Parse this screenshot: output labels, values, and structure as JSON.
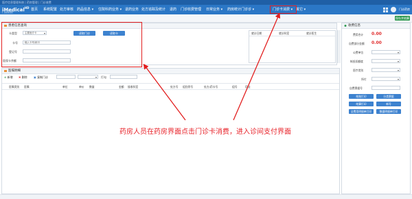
{
  "window": {
    "title": "医疗信息管理系统 | 药房管理 | 门诊收费"
  },
  "brand": {
    "name": "iMedical",
    "version": "HD",
    "subtitle": "门诊药房"
  },
  "nav": {
    "items": [
      {
        "label": "首页"
      },
      {
        "label": "系统配置"
      },
      {
        "label": "处方审核"
      },
      {
        "label": "药品信息 ▾"
      },
      {
        "label": "住院科药业务 ▾"
      },
      {
        "label": "退药业务"
      },
      {
        "label": "处方追踪及统计"
      },
      {
        "label": "退药"
      },
      {
        "label": "门诊收费管理"
      },
      {
        "label": "日常业务 ▾"
      },
      {
        "label": "药房统计门诊诊 ▾"
      },
      {
        "label": "门诊卡消费 ▾"
      },
      {
        "label": "其它 ▾"
      }
    ],
    "user": "门诊药房"
  },
  "toolbar": {
    "save_label": "保存并结算"
  },
  "patient_panel": {
    "title": "患者信息查询",
    "card_type_label": "卡类型",
    "card_type_value": "主要医疗卡",
    "card_no_label": "卡号",
    "card_no_placeholder": "输入卡号/刷卡",
    "reg_no_label": "登记号",
    "balance_label": "医保卡余额",
    "btn_read": "读取门诊",
    "btn_card": "读取卡"
  },
  "history_table": {
    "headers": [
      "就诊日期",
      "就诊科室",
      "就诊医生"
    ]
  },
  "order_panel": {
    "title": "医嘱明细",
    "tools": {
      "add": "新增",
      "delete": "删除",
      "copy": "复制门诊",
      "search_label": "打勾"
    },
    "headers": [
      "医嘱类别",
      "医嘱",
      "单位",
      "单价",
      "数量",
      "金额",
      "接收科室",
      "处方号",
      "组别序号",
      "处方/药卡号",
      "组号",
      "用法"
    ]
  },
  "annotation": {
    "text": "药房人员在药房界面点击门诊卡消费，进入诊间支付界面"
  },
  "pay_panel": {
    "title": "收费信息",
    "fields": [
      {
        "label": "费用合计",
        "value": "0.00"
      },
      {
        "label": "自费部分金额",
        "value": "0.00"
      },
      {
        "label": "公费单位",
        "value": ""
      },
      {
        "label": "帐抵扣额度",
        "value": ""
      },
      {
        "label": "医疗类别",
        "value": ""
      },
      {
        "label": "所付",
        "value": ""
      },
      {
        "label": "自费票据号",
        "value": ""
      }
    ],
    "buttons": [
      "结账打印",
      "分类票据",
      "结算打印",
      "新号",
      "全费用明细单打印",
      "数据明细单打印"
    ]
  },
  "colors": {
    "nav_bg": "#2b77c6",
    "accent_red": "#e21e1e",
    "button_blue": "#3d82cf",
    "save_green": "#2f9a52"
  }
}
